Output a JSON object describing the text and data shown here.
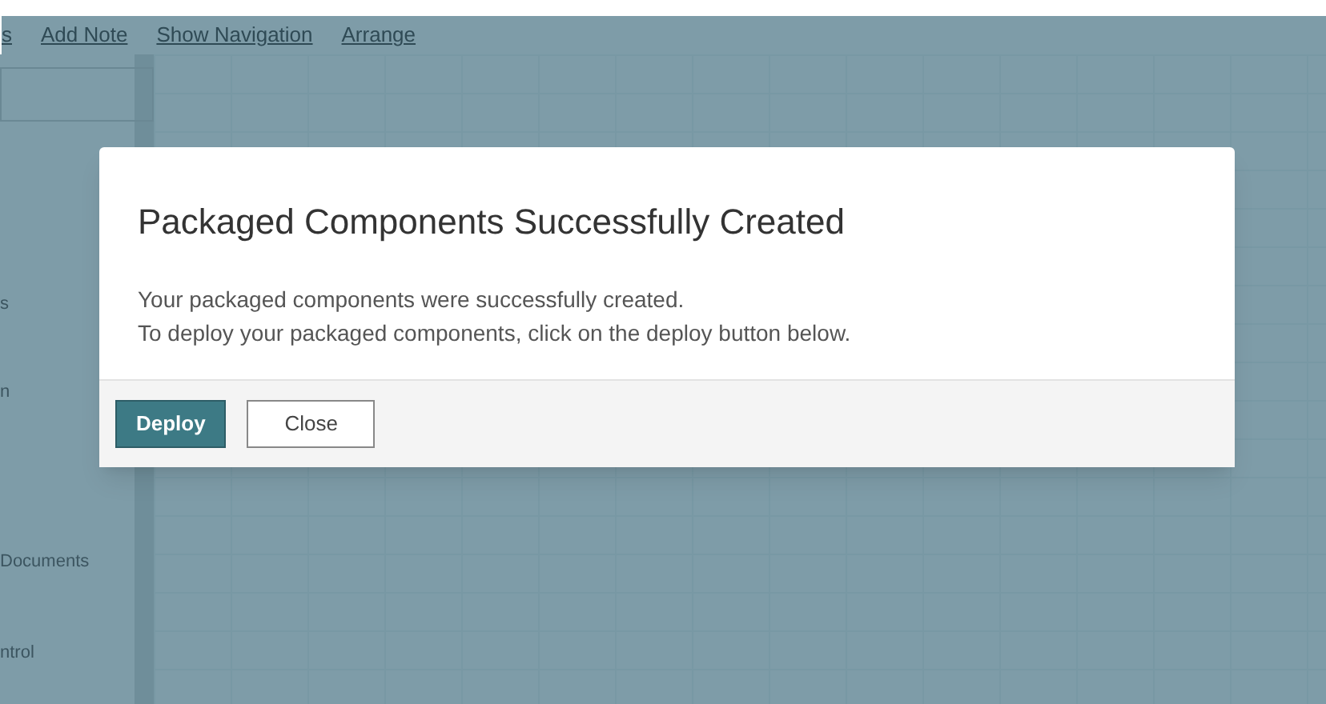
{
  "toolbar": {
    "links": [
      "s",
      "Add Note",
      "Show Navigation",
      "Arrange"
    ]
  },
  "sidebar": {
    "items": [
      {
        "label": "s"
      },
      {
        "label": "n"
      },
      {
        "label": "Documents"
      },
      {
        "label": "ntrol"
      }
    ]
  },
  "dialog": {
    "title": "Packaged Components Successfully Created",
    "message": [
      "Your packaged components were successfully created.",
      "To deploy your packaged components, click on the deploy button below."
    ],
    "buttons": [
      {
        "label": "Deploy",
        "kind": "primary"
      },
      {
        "label": "Close",
        "kind": "secondary"
      }
    ]
  }
}
